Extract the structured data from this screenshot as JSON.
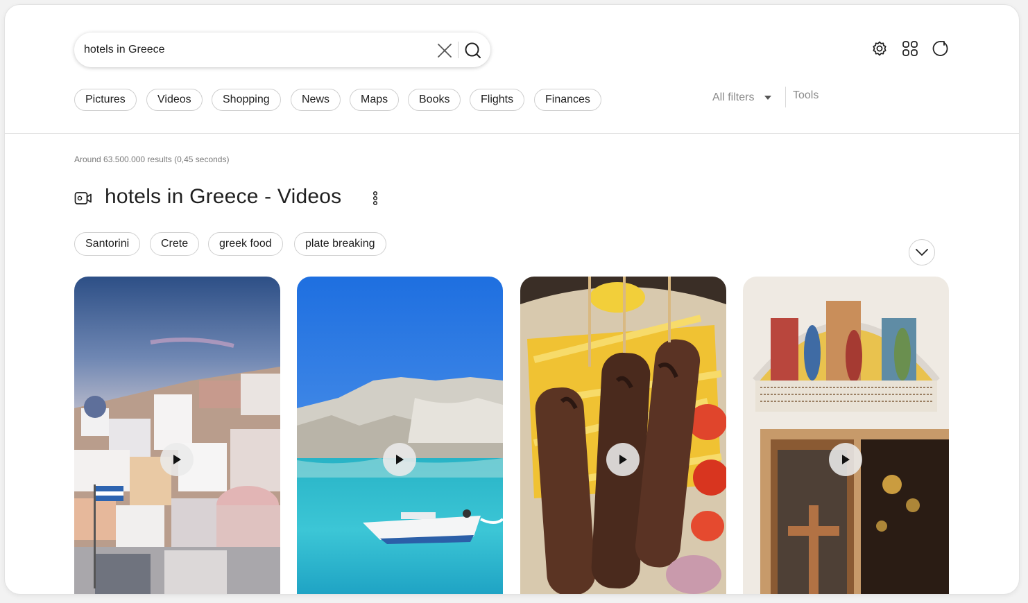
{
  "search": {
    "query": "hotels in Greece",
    "clear_icon": "close-icon",
    "search_icon": "search-icon"
  },
  "top_actions": {
    "settings_icon": "gear-icon",
    "apps_icon": "apps-grid-icon",
    "account_icon": "circle-arrow-icon"
  },
  "tabs": [
    "Pictures",
    "Videos",
    "Shopping",
    "News",
    "Maps",
    "Books",
    "Flights",
    "Finances"
  ],
  "filters": {
    "all_filters_label": "All filters",
    "tools_label": "Tools"
  },
  "results": {
    "stats": "Around 63.500.000 results (0,45 seconds)",
    "section_title": "hotels in Greece - Videos",
    "section_icon": "video-camera-icon",
    "more_icon": "more-vertical-icon",
    "expand_icon": "chevron-down-icon"
  },
  "topic_chips": [
    "Santorini",
    "Crete",
    "greek food",
    "plate breaking"
  ],
  "videos": [
    {
      "thumbnail": "santorini-village-photo",
      "play_icon": "play-icon"
    },
    {
      "thumbnail": "turquoise-sea-boat-photo",
      "play_icon": "play-icon"
    },
    {
      "thumbnail": "souvlaki-fries-photo",
      "play_icon": "play-icon"
    },
    {
      "thumbnail": "church-fresco-photo",
      "play_icon": "play-icon"
    }
  ],
  "colors": {
    "chip_border": "#cfcfcf",
    "muted_text": "#8a8a8a",
    "text": "#1f1f1f"
  }
}
